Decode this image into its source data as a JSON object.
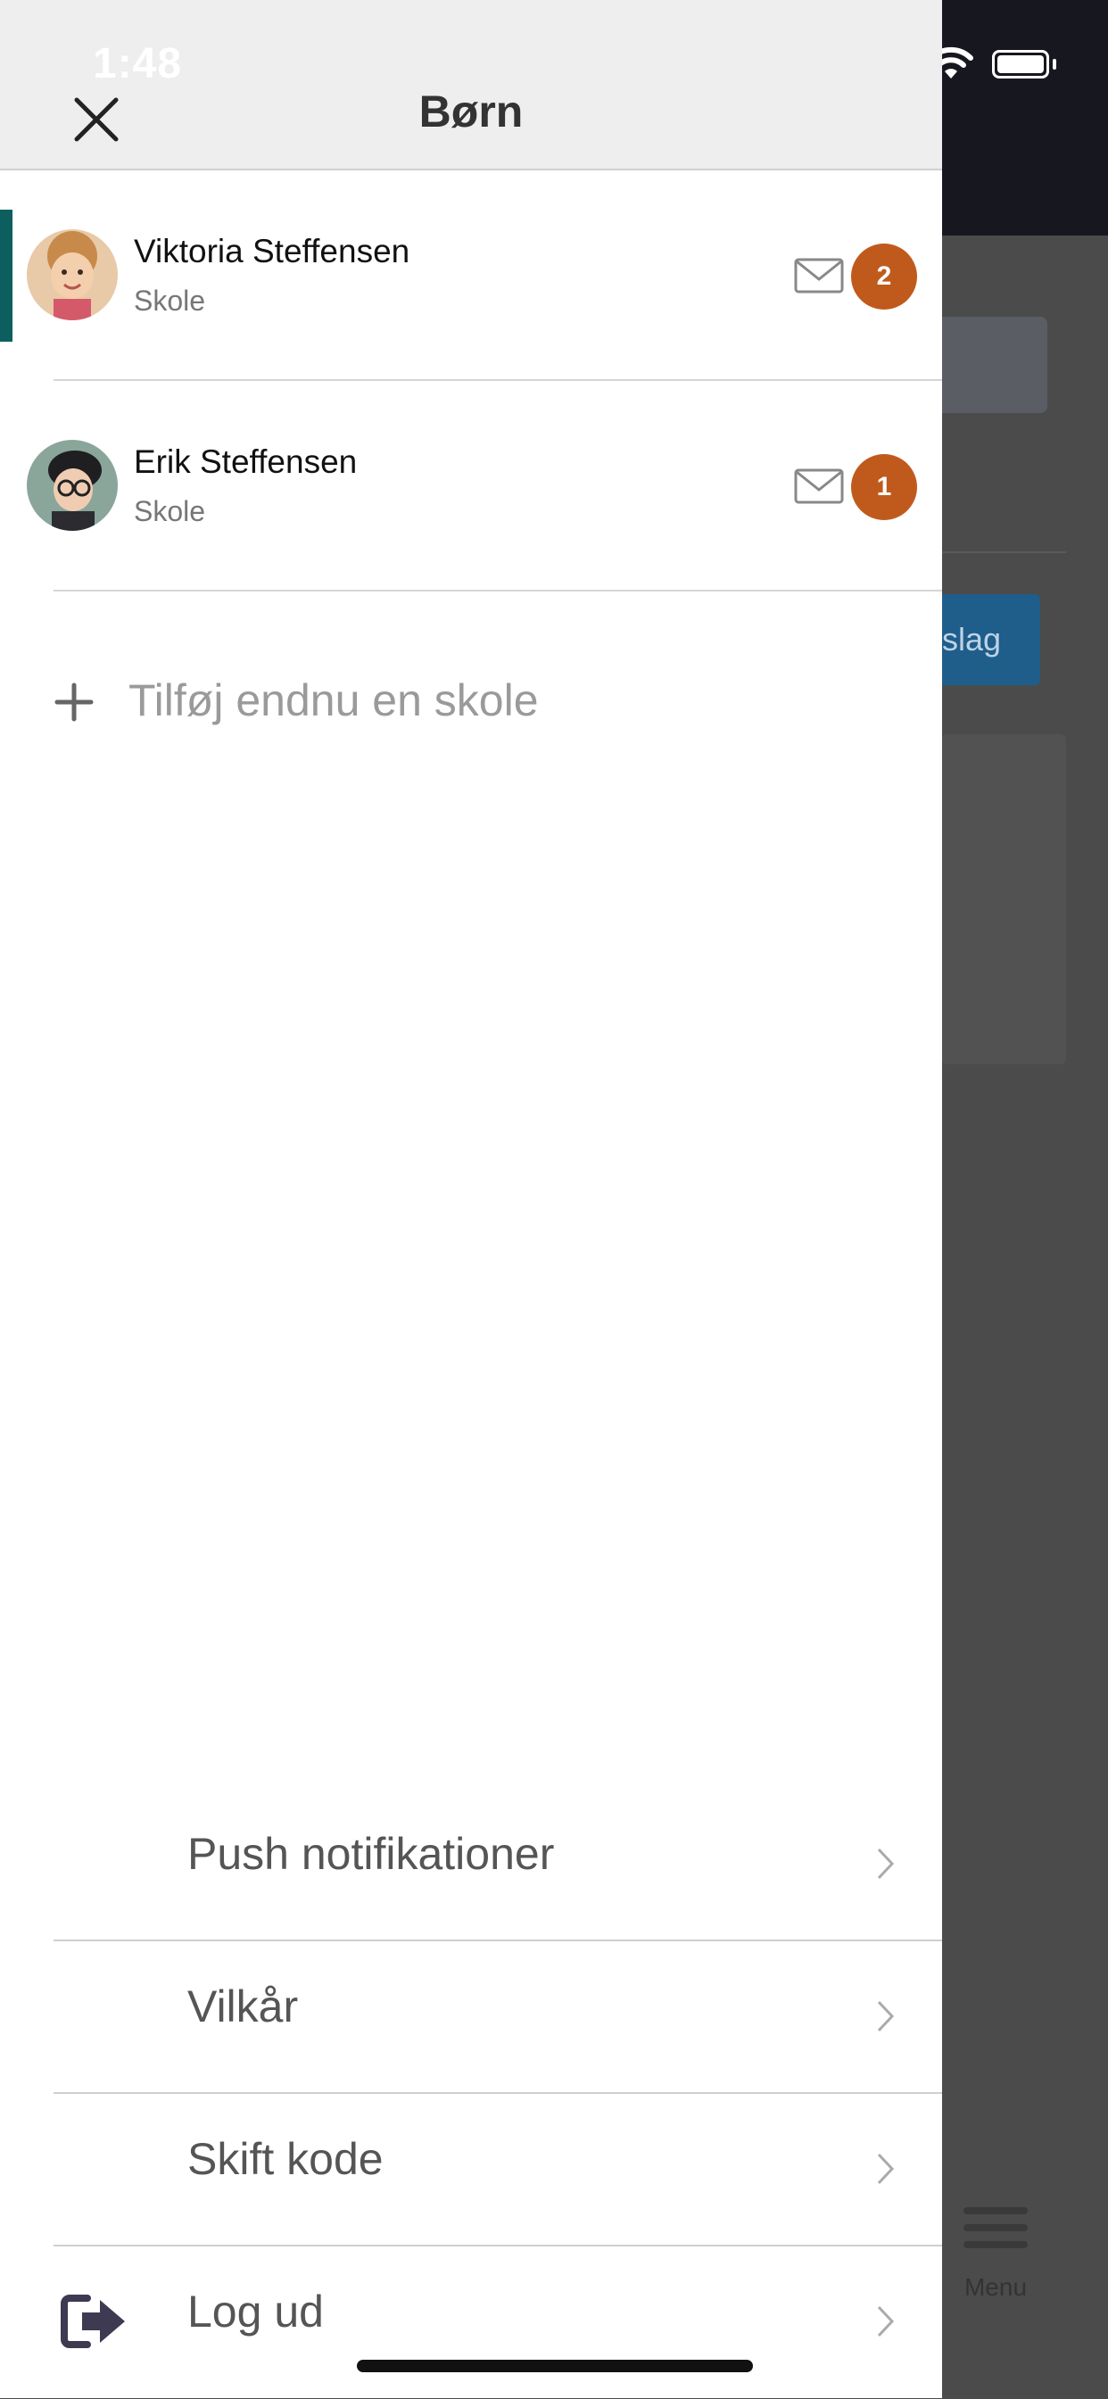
{
  "status_bar": {
    "time": "1:48"
  },
  "header": {
    "title": "Børn",
    "close_icon": "close-icon"
  },
  "children": [
    {
      "name": "Viktoria Steffensen",
      "school": "Skole",
      "unread": "2",
      "active": true
    },
    {
      "name": "Erik Steffensen",
      "school": "Skole",
      "unread": "1",
      "active": false
    }
  ],
  "add_school": {
    "label": "Tilføj endnu en skole",
    "icon": "plus-icon"
  },
  "menu": {
    "push": "Push notifikationer",
    "terms": "Vilkår",
    "change_code": "Skift kode",
    "logout": "Log ud"
  },
  "background": {
    "button_text": "oslag",
    "menu_label": "Menu"
  },
  "colors": {
    "accent": "#0d5f5f",
    "badge": "#c05a1c",
    "header_bg": "#eeeeee"
  }
}
